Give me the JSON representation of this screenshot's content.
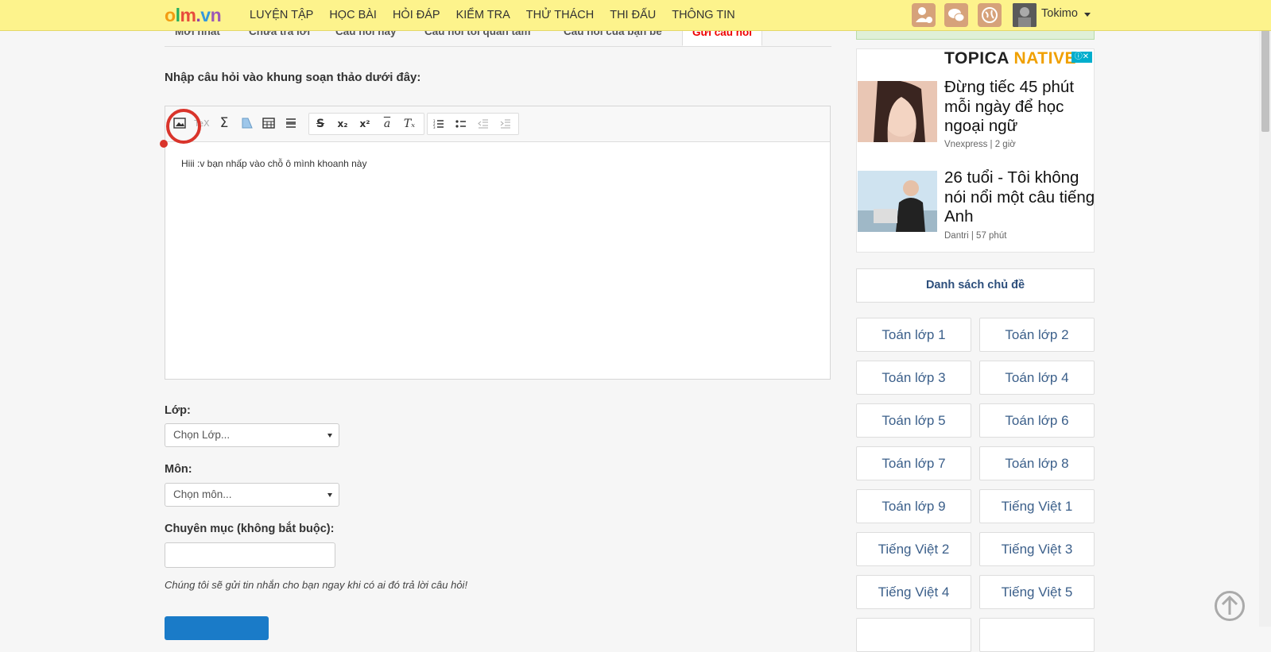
{
  "logo": {
    "o": "o",
    "l": "l",
    "m": "m",
    "dot": ".",
    "v": "v",
    "n": "n"
  },
  "nav": [
    "LUYỆN TẬP",
    "HỌC BÀI",
    "HỎI ĐÁP",
    "KIỂM TRA",
    "THỬ THÁCH",
    "THI ĐẤU",
    "THÔNG TIN"
  ],
  "user": {
    "name": "Tokimo"
  },
  "tabs": [
    "Mới nhất",
    "Chưa trả lời",
    "Câu hỏi hay",
    "Câu hỏi tôi quan tâm",
    "Câu hỏi của bạn bè",
    "Gửi câu hỏi"
  ],
  "intro": "Nhập câu hỏi vào khung soạn thảo dưới đây:",
  "editor": {
    "content": "Hiii :v bạn nhấp vào chỗ ô mình khoanh này",
    "icons": [
      "image-icon",
      "tex-icon",
      "sigma-icon",
      "shape-icon",
      "table-icon",
      "horizontal-line-icon",
      "strikethrough-icon",
      "subscript-icon",
      "superscript-icon",
      "font-icon",
      "remove-format-icon",
      "ordered-list-icon",
      "bullet-list-icon",
      "outdent-icon",
      "indent-icon"
    ]
  },
  "form": {
    "class_label": "Lớp:",
    "class_value": "Chọn Lớp...",
    "subject_label": "Môn:",
    "subject_value": "Chọn môn...",
    "topic_label": "Chuyên mục (không bắt buộc):",
    "note": "Chúng tôi sẽ gửi tin nhắn cho bạn ngay khi có ai đó trả lời câu hỏi!"
  },
  "ad": {
    "brand_a": "TOPICA",
    "brand_b": "NATIVE",
    "info": "ⓘ✕",
    "items": [
      {
        "title": "Đừng tiếc 45 phút mỗi ngày để học ngoại ngữ",
        "source": "Vnexpress | 2 giờ"
      },
      {
        "title": "26 tuổi - Tôi không nói nổi một câu tiếng Anh",
        "source": "Dantri | 57 phút"
      }
    ]
  },
  "sidebar": {
    "topic_title": "Danh sách chủ đề",
    "grades": [
      "Toán lớp 1",
      "Toán lớp 2",
      "Toán lớp 3",
      "Toán lớp 4",
      "Toán lớp 5",
      "Toán lớp 6",
      "Toán lớp 7",
      "Toán lớp 8",
      "Toán lớp 9",
      "Tiếng Việt 1",
      "Tiếng Việt 2",
      "Tiếng Việt 3",
      "Tiếng Việt 4",
      "Tiếng Việt 5"
    ]
  },
  "colors": {
    "topbar": "#fdf38c",
    "accent": "#e00000",
    "annotation": "#d9342b",
    "link": "#3b5f8a",
    "button": "#1a7bc8"
  }
}
